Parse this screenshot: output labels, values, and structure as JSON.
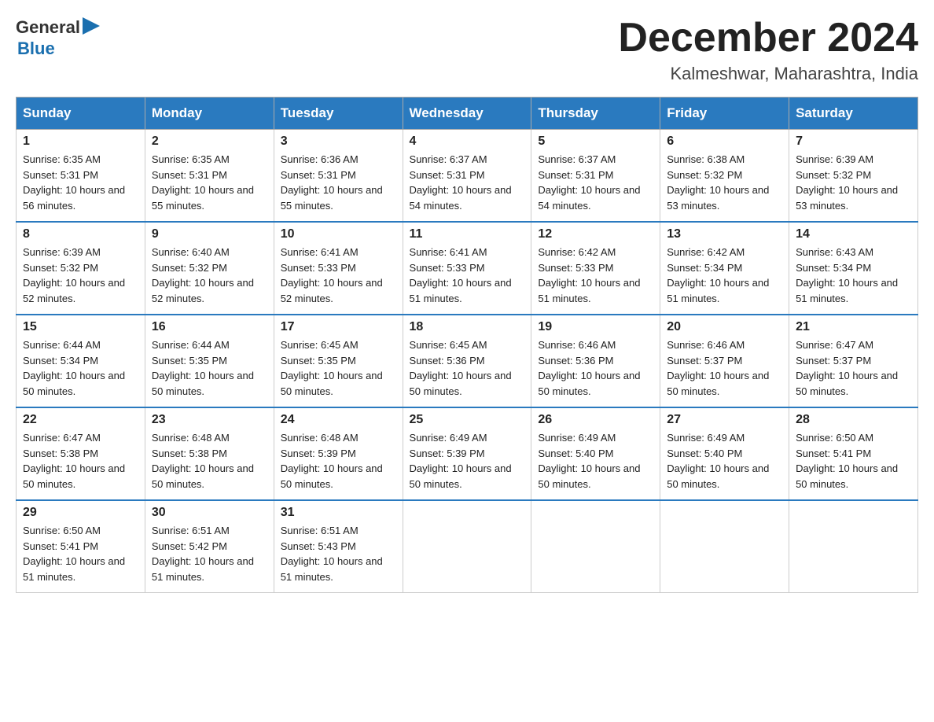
{
  "header": {
    "logo_general": "General",
    "logo_blue": "Blue",
    "month_title": "December 2024",
    "location": "Kalmeshwar, Maharashtra, India"
  },
  "columns": [
    "Sunday",
    "Monday",
    "Tuesday",
    "Wednesday",
    "Thursday",
    "Friday",
    "Saturday"
  ],
  "weeks": [
    [
      {
        "day": "1",
        "sunrise": "6:35 AM",
        "sunset": "5:31 PM",
        "daylight": "10 hours and 56 minutes."
      },
      {
        "day": "2",
        "sunrise": "6:35 AM",
        "sunset": "5:31 PM",
        "daylight": "10 hours and 55 minutes."
      },
      {
        "day": "3",
        "sunrise": "6:36 AM",
        "sunset": "5:31 PM",
        "daylight": "10 hours and 55 minutes."
      },
      {
        "day": "4",
        "sunrise": "6:37 AM",
        "sunset": "5:31 PM",
        "daylight": "10 hours and 54 minutes."
      },
      {
        "day": "5",
        "sunrise": "6:37 AM",
        "sunset": "5:31 PM",
        "daylight": "10 hours and 54 minutes."
      },
      {
        "day": "6",
        "sunrise": "6:38 AM",
        "sunset": "5:32 PM",
        "daylight": "10 hours and 53 minutes."
      },
      {
        "day": "7",
        "sunrise": "6:39 AM",
        "sunset": "5:32 PM",
        "daylight": "10 hours and 53 minutes."
      }
    ],
    [
      {
        "day": "8",
        "sunrise": "6:39 AM",
        "sunset": "5:32 PM",
        "daylight": "10 hours and 52 minutes."
      },
      {
        "day": "9",
        "sunrise": "6:40 AM",
        "sunset": "5:32 PM",
        "daylight": "10 hours and 52 minutes."
      },
      {
        "day": "10",
        "sunrise": "6:41 AM",
        "sunset": "5:33 PM",
        "daylight": "10 hours and 52 minutes."
      },
      {
        "day": "11",
        "sunrise": "6:41 AM",
        "sunset": "5:33 PM",
        "daylight": "10 hours and 51 minutes."
      },
      {
        "day": "12",
        "sunrise": "6:42 AM",
        "sunset": "5:33 PM",
        "daylight": "10 hours and 51 minutes."
      },
      {
        "day": "13",
        "sunrise": "6:42 AM",
        "sunset": "5:34 PM",
        "daylight": "10 hours and 51 minutes."
      },
      {
        "day": "14",
        "sunrise": "6:43 AM",
        "sunset": "5:34 PM",
        "daylight": "10 hours and 51 minutes."
      }
    ],
    [
      {
        "day": "15",
        "sunrise": "6:44 AM",
        "sunset": "5:34 PM",
        "daylight": "10 hours and 50 minutes."
      },
      {
        "day": "16",
        "sunrise": "6:44 AM",
        "sunset": "5:35 PM",
        "daylight": "10 hours and 50 minutes."
      },
      {
        "day": "17",
        "sunrise": "6:45 AM",
        "sunset": "5:35 PM",
        "daylight": "10 hours and 50 minutes."
      },
      {
        "day": "18",
        "sunrise": "6:45 AM",
        "sunset": "5:36 PM",
        "daylight": "10 hours and 50 minutes."
      },
      {
        "day": "19",
        "sunrise": "6:46 AM",
        "sunset": "5:36 PM",
        "daylight": "10 hours and 50 minutes."
      },
      {
        "day": "20",
        "sunrise": "6:46 AM",
        "sunset": "5:37 PM",
        "daylight": "10 hours and 50 minutes."
      },
      {
        "day": "21",
        "sunrise": "6:47 AM",
        "sunset": "5:37 PM",
        "daylight": "10 hours and 50 minutes."
      }
    ],
    [
      {
        "day": "22",
        "sunrise": "6:47 AM",
        "sunset": "5:38 PM",
        "daylight": "10 hours and 50 minutes."
      },
      {
        "day": "23",
        "sunrise": "6:48 AM",
        "sunset": "5:38 PM",
        "daylight": "10 hours and 50 minutes."
      },
      {
        "day": "24",
        "sunrise": "6:48 AM",
        "sunset": "5:39 PM",
        "daylight": "10 hours and 50 minutes."
      },
      {
        "day": "25",
        "sunrise": "6:49 AM",
        "sunset": "5:39 PM",
        "daylight": "10 hours and 50 minutes."
      },
      {
        "day": "26",
        "sunrise": "6:49 AM",
        "sunset": "5:40 PM",
        "daylight": "10 hours and 50 minutes."
      },
      {
        "day": "27",
        "sunrise": "6:49 AM",
        "sunset": "5:40 PM",
        "daylight": "10 hours and 50 minutes."
      },
      {
        "day": "28",
        "sunrise": "6:50 AM",
        "sunset": "5:41 PM",
        "daylight": "10 hours and 50 minutes."
      }
    ],
    [
      {
        "day": "29",
        "sunrise": "6:50 AM",
        "sunset": "5:41 PM",
        "daylight": "10 hours and 51 minutes."
      },
      {
        "day": "30",
        "sunrise": "6:51 AM",
        "sunset": "5:42 PM",
        "daylight": "10 hours and 51 minutes."
      },
      {
        "day": "31",
        "sunrise": "6:51 AM",
        "sunset": "5:43 PM",
        "daylight": "10 hours and 51 minutes."
      },
      null,
      null,
      null,
      null
    ]
  ]
}
